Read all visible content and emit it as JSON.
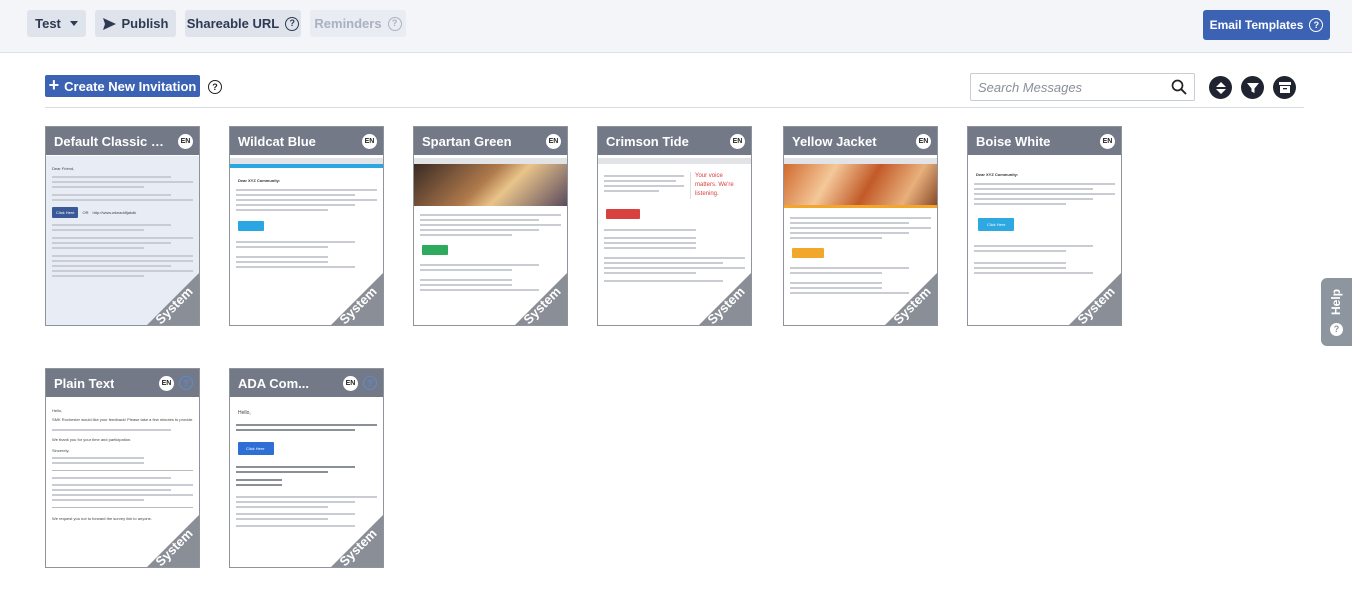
{
  "toolbar": {
    "test_label": "Test",
    "publish_label": "Publish",
    "shareable_url_label": "Shareable URL",
    "reminders_label": "Reminders",
    "email_templates_label": "Email Templates"
  },
  "actions": {
    "create_label": "Create New Invitation",
    "search_placeholder": "Search Messages"
  },
  "cards": [
    {
      "title": "Default Classic Sy...",
      "lang": "EN",
      "tag": "System"
    },
    {
      "title": "Wildcat Blue",
      "lang": "EN",
      "tag": "System"
    },
    {
      "title": "Spartan Green",
      "lang": "EN",
      "tag": "System"
    },
    {
      "title": "Crimson Tide",
      "lang": "EN",
      "tag": "System"
    },
    {
      "title": "Yellow Jacket",
      "lang": "EN",
      "tag": "System"
    },
    {
      "title": "Boise White",
      "lang": "EN",
      "tag": "System"
    },
    {
      "title": "Plain Text",
      "lang": "EN",
      "tag": "System"
    },
    {
      "title": "ADA Com...",
      "lang": "EN",
      "tag": "System"
    }
  ],
  "previews": {
    "default_greeting": "Dear Friend,",
    "default_button": "Click Here",
    "default_or": "OR",
    "default_link": "http://www.wkeaddfjakdk",
    "wildcat_greeting": "Dear XYZ Community:",
    "crimson_tagline": "Your voice matters. We're listening.",
    "boise_greeting": "Dear XYZ Community:",
    "boise_button": "Click Here",
    "plain_greeting": "Hello,",
    "plain_intro": "SMK Rochester would like your feedback! Please take a few minutes to provide",
    "plain_thanks": "We thank you for your time and participation.",
    "plain_signoff": "Sincerely,",
    "plain_footer": "We request you not to forward the survey link to anyone.",
    "ada_greeting": "Hello,",
    "ada_button": "Click Here"
  },
  "help_tab": {
    "label": "Help"
  },
  "colors": {
    "primary": "#3c63b3",
    "card_header": "#737987",
    "wildcat": "#2aa6e3",
    "spartan": "#2eaa5c",
    "crimson": "#d8413f",
    "yellow": "#f2a72c",
    "boise": "#2ea8e0"
  }
}
